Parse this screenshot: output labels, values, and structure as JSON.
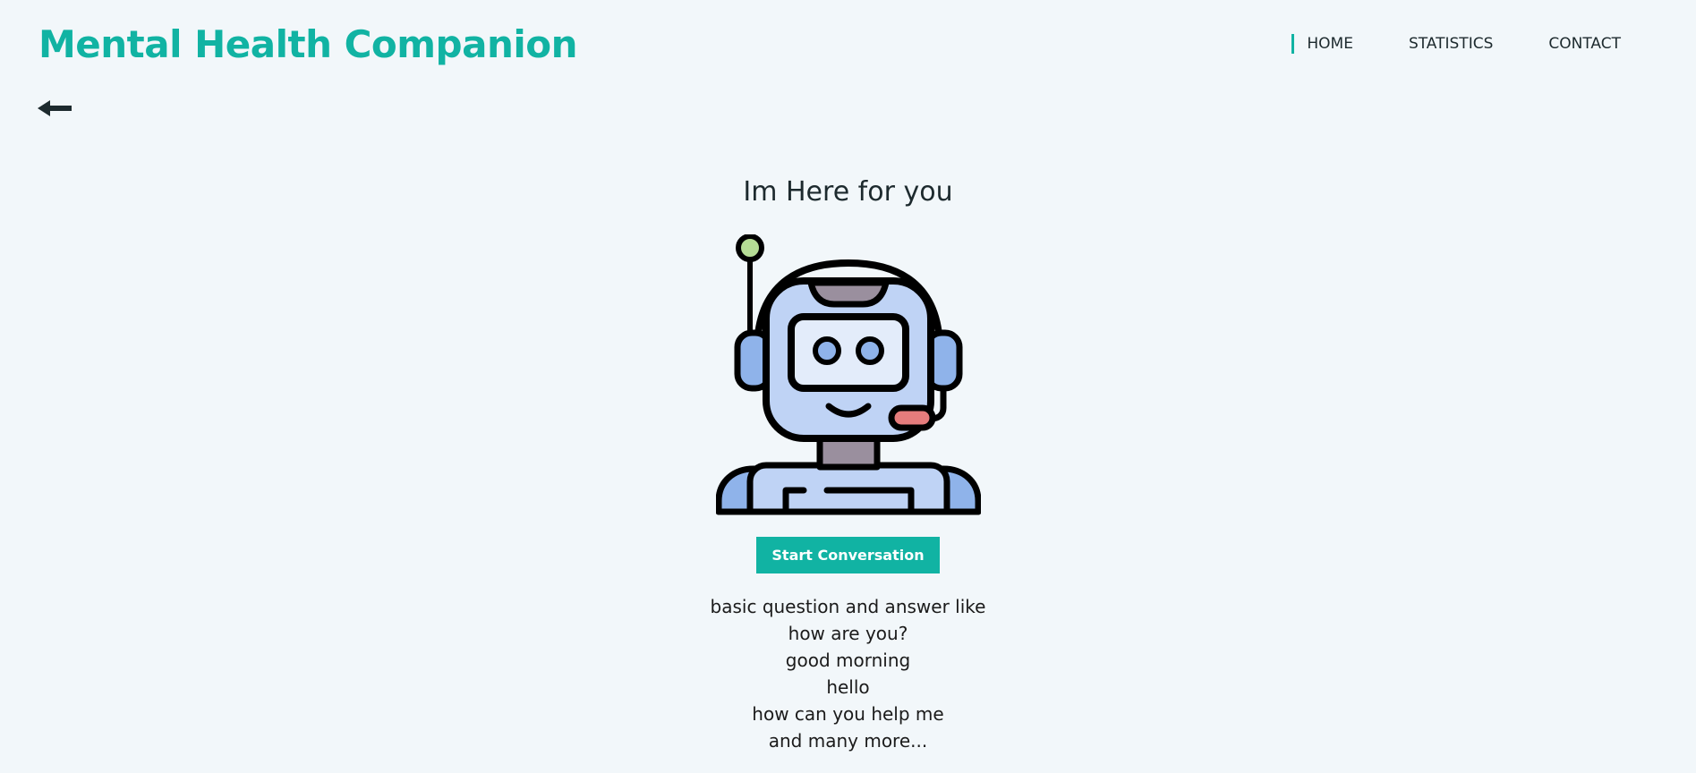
{
  "header": {
    "brand": "Mental Health Companion",
    "nav": [
      {
        "label": "HOME"
      },
      {
        "label": "STATISTICS"
      },
      {
        "label": "CONTACT"
      }
    ]
  },
  "main": {
    "headline": "Im Here for you",
    "cta_label": "Start Conversation",
    "examples": [
      "basic question and answer like",
      "how are you?",
      "good morning",
      "hello",
      "how can you help me",
      "and many more..."
    ]
  },
  "icons": {
    "back": "arrow-left-icon",
    "illustration": "chatbot-robot-illustration"
  },
  "colors": {
    "accent": "#11b3a3",
    "background": "#f2f7fa",
    "text": "#1d2a2e"
  }
}
